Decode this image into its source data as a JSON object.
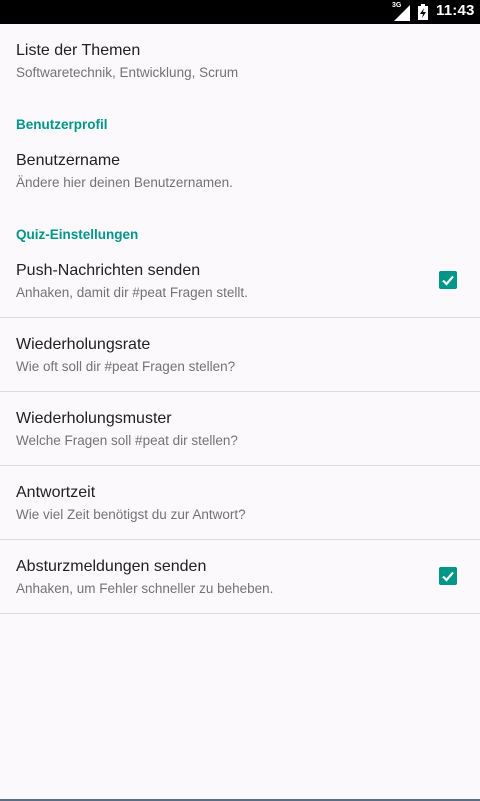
{
  "status_bar": {
    "network": "3G",
    "time": "11:43"
  },
  "topics": {
    "title": "Liste der Themen",
    "summary": "Softwaretechnik, Entwicklung, Scrum"
  },
  "profile_category": "Benutzerprofil",
  "username": {
    "title": "Benutzername",
    "summary": "Ändere hier deinen Benutzernamen."
  },
  "quiz_category": "Quiz-Einstellungen",
  "push": {
    "title": "Push-Nachrichten senden",
    "summary": "Anhaken, damit dir #peat Fragen stellt.",
    "checked": true
  },
  "repetition_rate": {
    "title": "Wiederholungsrate",
    "summary": "Wie oft soll dir #peat Fragen stellen?"
  },
  "repetition_pattern": {
    "title": "Wiederholungsmuster",
    "summary": "Welche Fragen soll #peat dir stellen?"
  },
  "answer_time": {
    "title": "Antwortzeit",
    "summary": "Wie viel Zeit benötigst du zur Antwort?"
  },
  "crash_reports": {
    "title": "Absturzmeldungen senden",
    "summary": "Anhaken, um Fehler schneller zu beheben.",
    "checked": true
  },
  "colors": {
    "accent": "#009688",
    "background": "#fcf9fd",
    "status_bar": "#000000"
  }
}
